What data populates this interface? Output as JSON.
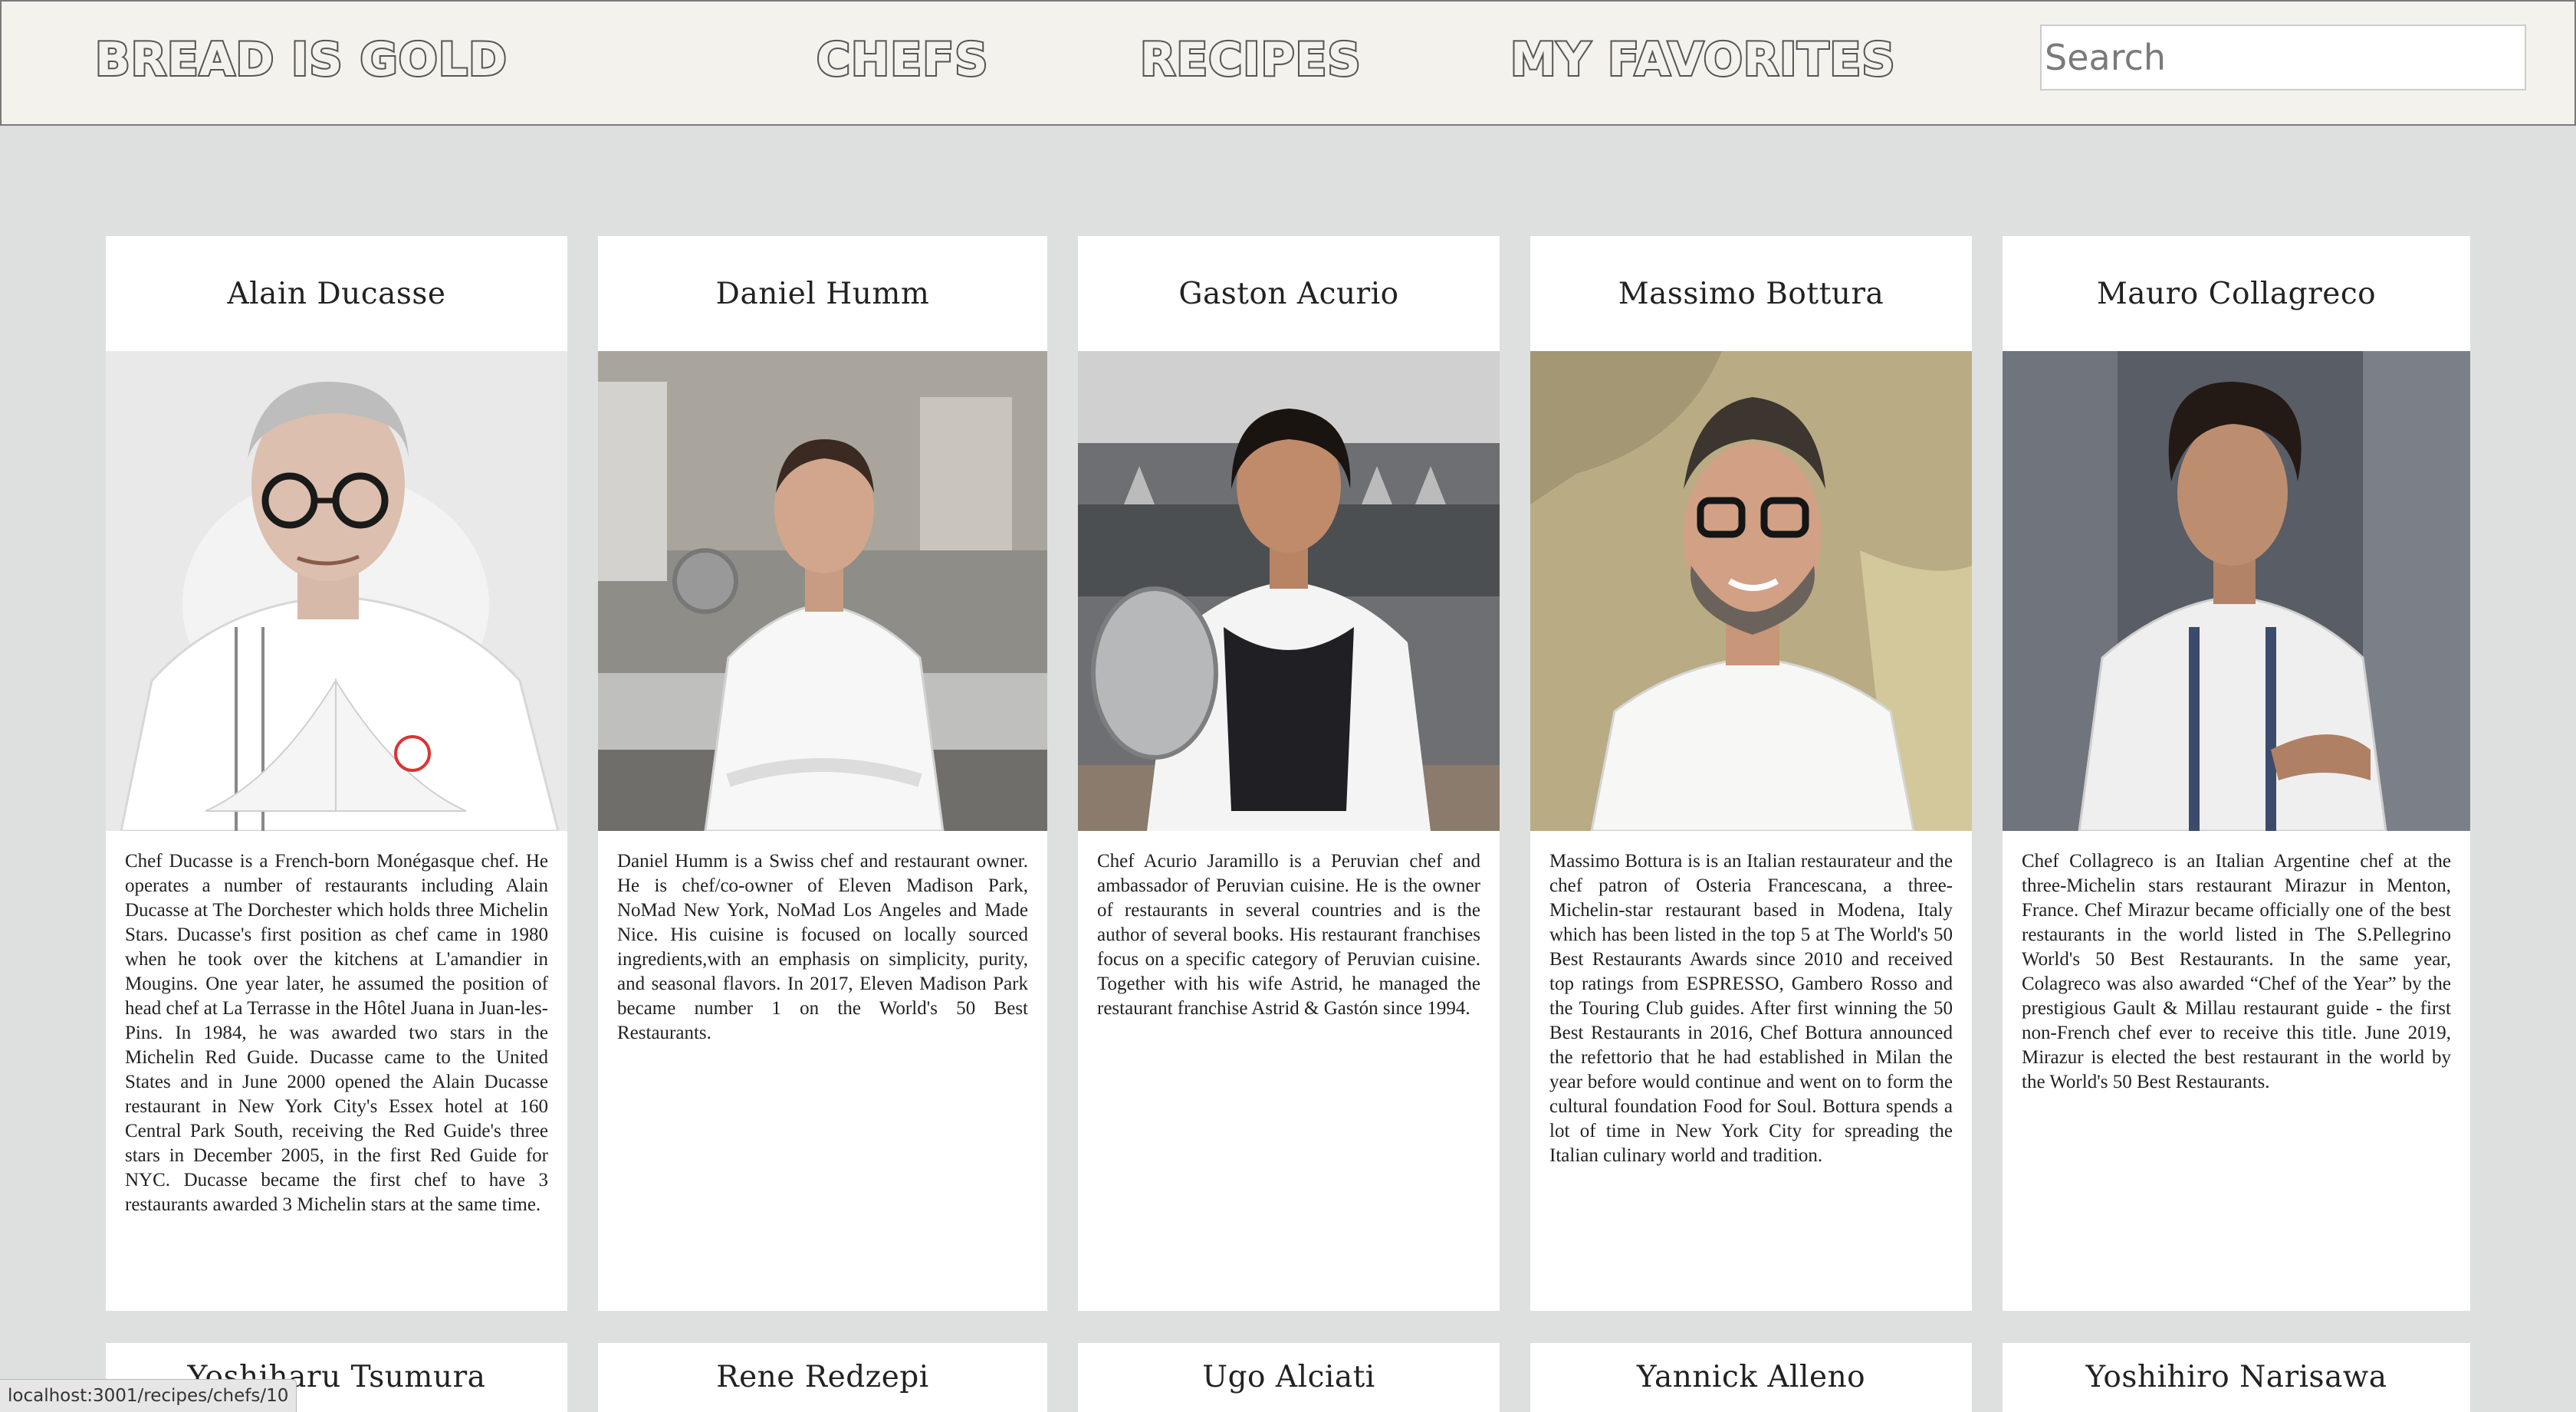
{
  "nav": {
    "brand": "Bread is Gold",
    "links": [
      "Chefs",
      "Recipes",
      "My Favorites"
    ],
    "search_placeholder": "Search"
  },
  "chefs": [
    {
      "name": "Alain Ducasse",
      "description": "Chef Ducasse is a French-born Monégasque chef. He operates a number of restaurants including Alain Ducasse at The Dorchester which holds three Michelin Stars. Ducasse's first position as chef came in 1980 when he took over the kitchens at L'amandier in Mougins. One year later, he assumed the position of head chef at La Terrasse in the Hôtel Juana in Juan-les-Pins. In 1984, he was awarded two stars in the Michelin Red Guide. Ducasse came to the United States and in June 2000 opened the Alain Ducasse restaurant in New York City's Essex hotel at 160 Central Park South, receiving the Red Guide's three stars in December 2005, in the first Red Guide for NYC. Ducasse became the first chef to have 3 restaurants awarded 3 Michelin stars at the same time."
    },
    {
      "name": "Daniel Humm",
      "description": "Daniel Humm is a Swiss chef and restaurant owner. He is chef/co-owner of Eleven Madison Park, NoMad New York, NoMad Los Angeles and Made Nice. His cuisine is focused on locally sourced ingredients,with an emphasis on simplicity, purity, and seasonal flavors. In 2017, Eleven Madison Park became number 1 on the World's 50 Best Restaurants."
    },
    {
      "name": "Gaston Acurio",
      "description": "Chef Acurio Jaramillo is a Peruvian chef and ambassador of Peruvian cuisine. He is the owner of restaurants in several countries and is the author of several books. His restaurant franchises focus on a specific category of Peruvian cuisine. Together with his wife Astrid, he managed the restaurant franchise Astrid & Gastón since 1994."
    },
    {
      "name": "Massimo Bottura",
      "description": "Massimo Bottura is is an Italian restaurateur and the chef patron of Osteria Francescana, a three-Michelin-star restaurant based in Modena, Italy which has been listed in the top 5 at The World's 50 Best Restaurants Awards since 2010 and received top ratings from ESPRESSO, Gambero Rosso and the Touring Club guides. After first winning the 50 Best Restaurants in 2016, Chef Bottura announced the refettorio that he had established in Milan the year before would continue and went on to form the cultural foundation Food for Soul. Bottura spends a lot of time in New York City for spreading the Italian culinary world and tradition."
    },
    {
      "name": "Mauro Collagreco",
      "description": "Chef Collagreco is an Italian Argentine chef at the three-Michelin stars restaurant Mirazur in Menton, France. Chef Mirazur became officially one of the best restaurants in the world listed in The S.Pellegrino World's 50 Best Restaurants. In the same year, Colagreco was also awarded “Chef of the Year” by the prestigious Gault & Millau restaurant guide - the first non-French chef ever to receive this title. June 2019, Mirazur is elected the best restaurant in the world by the World's 50 Best Restaurants."
    }
  ],
  "chefs_row2": [
    {
      "name": "Yoshiharu Tsumura"
    },
    {
      "name": "Rene Redzepi"
    },
    {
      "name": "Ugo Alciati"
    },
    {
      "name": "Yannick Alleno"
    },
    {
      "name": "Yoshihiro Narisawa"
    }
  ],
  "status_url": "localhost:3001/recipes/chefs/10",
  "colors": {
    "page_background": "#dde0df",
    "navbar_background": "#f4f2ec",
    "nav_text_outline": "#555555",
    "card_background": "#ffffff"
  }
}
